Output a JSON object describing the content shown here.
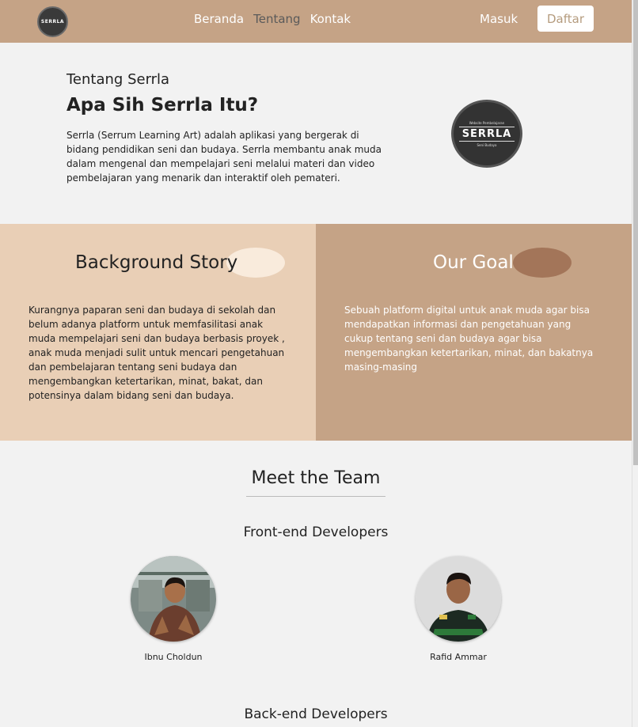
{
  "navbar": {
    "logo_text": "SERRLA",
    "links": [
      "Beranda",
      "Tentang",
      "Kontak"
    ],
    "login": "Masuk",
    "register": "Daftar"
  },
  "about": {
    "subtitle": "Tentang Serrla",
    "title": "Apa Sih Serrla Itu?",
    "description": "Serrla (Serrum Learning Art) adalah aplikasi yang bergerak di bidang pendidikan seni dan budaya. Serrla membantu anak muda dalam mengenal dan mempelajari seni melalui materi dan video pembelajaran yang menarik dan interaktif oleh pemateri.",
    "logo": {
      "top": "Website Pembelajaran",
      "main": "SERRLA",
      "bottom": "Seni Budaya"
    }
  },
  "background_story": {
    "title": "Background Story",
    "text": "Kurangnya paparan seni dan budaya di sekolah dan belum adanya platform untuk memfasilitasi anak muda mempelajari seni dan budaya berbasis proyek , anak muda menjadi sulit untuk mencari pengetahuan dan pembelajaran tentang seni budaya dan mengembangkan ketertarikan, minat, bakat, dan potensinya dalam bidang seni dan budaya."
  },
  "our_goal": {
    "title": "Our Goal",
    "text": "Sebuah platform digital untuk anak muda agar bisa mendapatkan informasi dan pengetahuan yang cukup tentang seni dan budaya agar bisa mengembangkan ketertarikan, minat, dan bakatnya masing-masing"
  },
  "team": {
    "title": "Meet the Team",
    "frontend_title": "Front-end Developers",
    "frontend_members": [
      "Ibnu Choldun",
      "Rafid Ammar"
    ],
    "backend_title": "Back-end Developers"
  },
  "colors": {
    "navbar": "#c5a386",
    "panel_left": "#e9cfb6",
    "panel_right": "#c5a386"
  }
}
